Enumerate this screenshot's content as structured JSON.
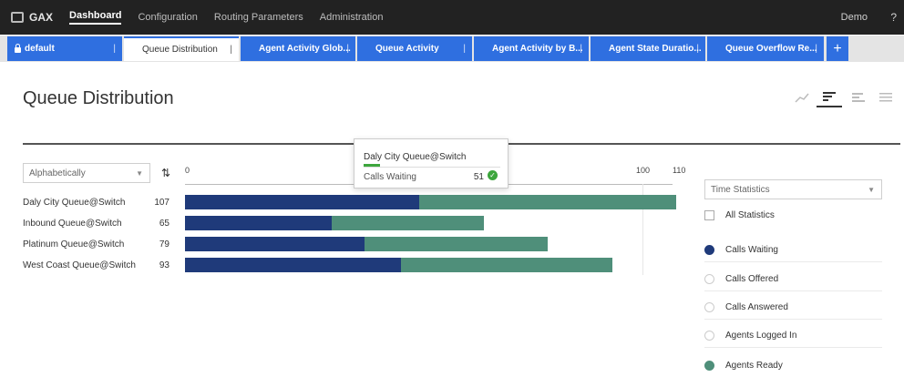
{
  "topbar": {
    "brand": "GAX",
    "nav": [
      "Dashboard",
      "Configuration",
      "Routing Parameters",
      "Administration"
    ],
    "user": "Demo",
    "help": "?"
  },
  "tabs": [
    {
      "label": "default",
      "icon": "lock-icon"
    },
    {
      "label": "Queue Distribution",
      "active": true
    },
    {
      "label": "Agent Activity Glob..."
    },
    {
      "label": "Queue Activity"
    },
    {
      "label": "Agent Activity by B..."
    },
    {
      "label": "Agent State Duratio..."
    },
    {
      "label": "Queue Overflow Re..."
    }
  ],
  "tab_add": "+",
  "tab_separator": "|",
  "page_title": "Queue Distribution",
  "view_icons": [
    "line-chart-icon",
    "bar-chart-icon",
    "grouped-bar-icon",
    "list-icon"
  ],
  "sort": {
    "value": "Alphabetically",
    "toggle_icon": "sort-toggle-icon"
  },
  "axis_ticks": [
    "0",
    "100",
    "110"
  ],
  "chart_data": {
    "type": "bar",
    "orientation": "horizontal",
    "stacked": true,
    "categories": [
      "Daly City Queue@Switch",
      "Inbound Queue@Switch",
      "Platinum Queue@Switch",
      "West Coast Queue@Switch"
    ],
    "totals": [
      107,
      65,
      79,
      93
    ],
    "series": [
      {
        "name": "Calls Waiting",
        "color": "#1f3a7a",
        "values": [
          51,
          32,
          39,
          47
        ]
      },
      {
        "name": "Agents Ready",
        "color": "#4f8f7a",
        "values": [
          56,
          33,
          40,
          46
        ]
      }
    ],
    "xlim": [
      0,
      110
    ]
  },
  "tooltip": {
    "title": "Daly City Queue@Switch",
    "label": "Calls Waiting",
    "value": "51",
    "icon": "check-circle-icon"
  },
  "statistics": {
    "select": "Time Statistics",
    "all_label": "All Statistics",
    "items": [
      {
        "label": "Calls Waiting",
        "selected": true,
        "color": "#1f3a7a"
      },
      {
        "label": "Calls Offered",
        "selected": false
      },
      {
        "label": "Calls Answered",
        "selected": false
      },
      {
        "label": "Agents Logged In",
        "selected": false
      },
      {
        "label": "Agents Ready",
        "selected": true,
        "color": "#4f8f7a"
      }
    ]
  }
}
